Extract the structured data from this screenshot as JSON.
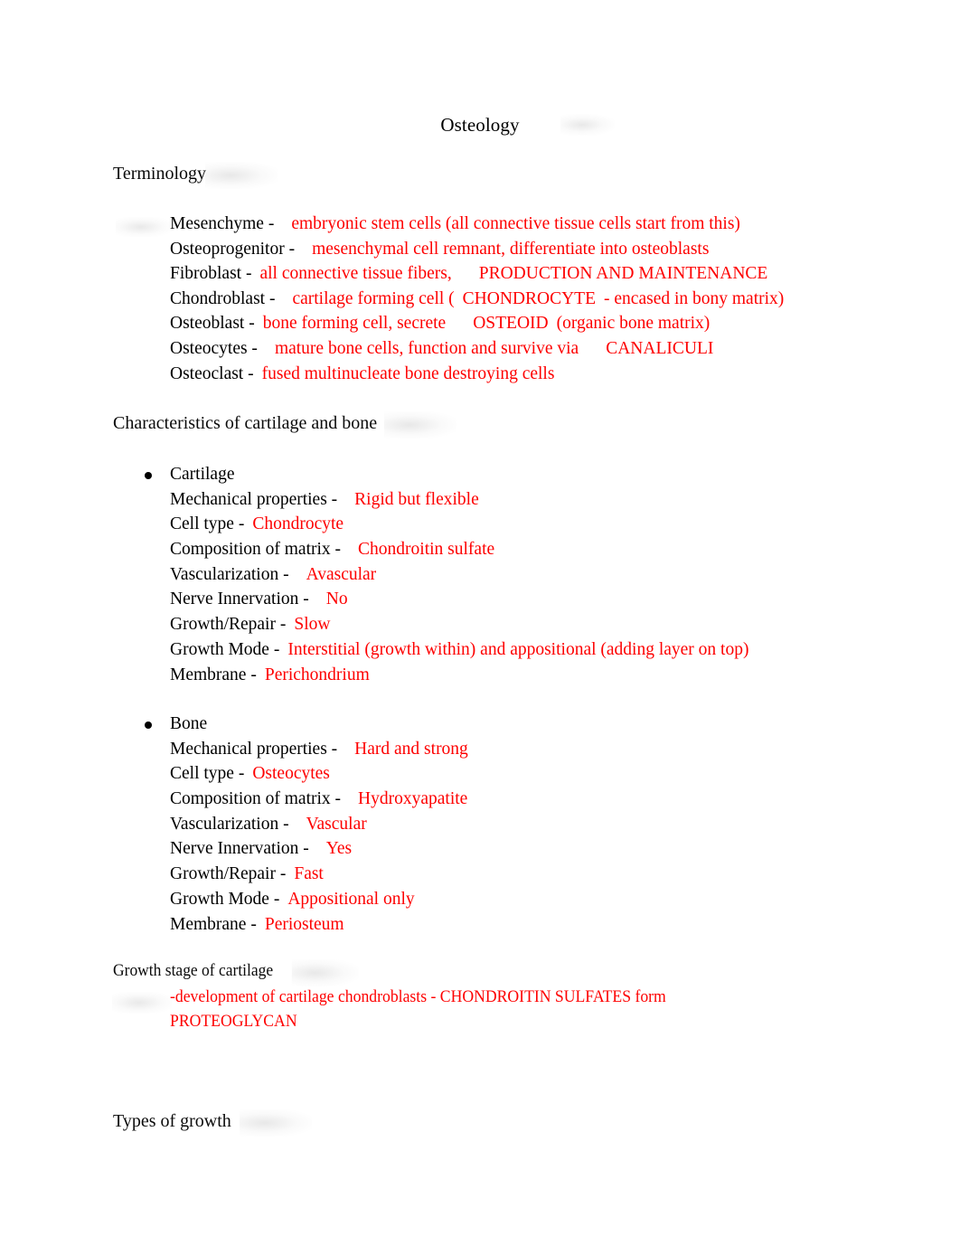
{
  "document": {
    "title": "Osteology"
  },
  "sections": {
    "terminology": {
      "heading": "Terminology",
      "entries": [
        {
          "term": "Mesenchyme -",
          "definition": "embryonic stem cells (all connective tissue cells start from this)"
        },
        {
          "term": "Osteoprogenitor -",
          "definition": "mesenchymal cell remnant, differentiate into osteoblasts"
        },
        {
          "term": "Fibroblast -",
          "definition": "all connective tissue fibers,",
          "definition2": "PRODUCTION AND MAINTENANCE"
        },
        {
          "term": "Chondroblast -",
          "definition": "cartilage forming cell (",
          "definition2": "CHONDROCYTE",
          "definition3": "- encased in bony matrix)"
        },
        {
          "term": "Osteoblast -",
          "definition": "bone forming cell, secrete",
          "definition2": "OSTEOID",
          "definition3": "(organic bone matrix)"
        },
        {
          "term": "Osteocytes -",
          "definition": "mature bone cells, function and survive via",
          "definition2": "CANALICULI"
        },
        {
          "term": "Osteoclast -",
          "definition": "fused multinucleate bone destroying cells"
        }
      ]
    },
    "characteristics": {
      "heading": "Characteristics of cartilage and bone",
      "groups": [
        {
          "name": "Cartilage",
          "properties": [
            {
              "label": "Mechanical properties -",
              "value": "Rigid but flexible"
            },
            {
              "label": "Cell type -",
              "value": "Chondrocyte"
            },
            {
              "label": "Composition of matrix -",
              "value": "Chondroitin sulfate"
            },
            {
              "label": "Vascularization -",
              "value": "Avascular"
            },
            {
              "label": "Nerve Innervation -",
              "value": "No"
            },
            {
              "label": "Growth/Repair -",
              "value": "Slow"
            },
            {
              "label": "Growth Mode -",
              "value": "Interstitial (growth within) and appositional (adding layer on top)"
            },
            {
              "label": "Membrane -",
              "value": "Perichondrium"
            }
          ]
        },
        {
          "name": "Bone",
          "properties": [
            {
              "label": "Mechanical properties -",
              "value": "Hard and strong"
            },
            {
              "label": "Cell type -",
              "value": "Osteocytes"
            },
            {
              "label": "Composition of matrix -",
              "value": "Hydroxyapatite"
            },
            {
              "label": "Vascularization -",
              "value": "Vascular"
            },
            {
              "label": "Nerve Innervation -",
              "value": "Yes"
            },
            {
              "label": "Growth/Repair -",
              "value": "Fast"
            },
            {
              "label": "Growth Mode -",
              "value": "Appositional only"
            },
            {
              "label": "Membrane -",
              "value": "Periosteum"
            }
          ]
        }
      ]
    },
    "growth_stage": {
      "heading": "Growth stage of cartilage",
      "body": "-development of cartilage chondroblasts - CHONDROITIN SULFATES form PROTEOGLYCAN"
    },
    "types_of_growth": {
      "heading": "Types of growth"
    }
  },
  "colors": {
    "text": "#000000",
    "accent_red": "#FE0000",
    "background": "#FFFFFF"
  }
}
